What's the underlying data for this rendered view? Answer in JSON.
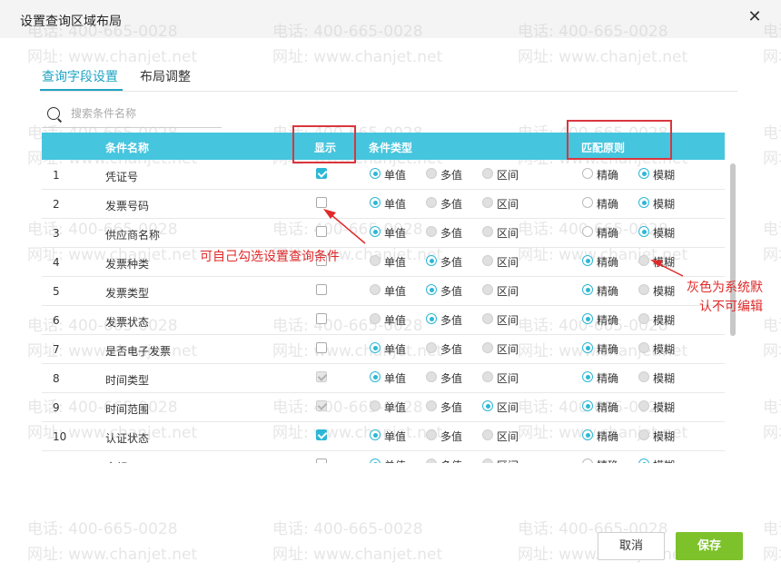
{
  "dialog": {
    "title": "设置查询区域布局",
    "close_icon": "close-icon"
  },
  "watermark": {
    "phone": "电话: 400-665-0028",
    "site": "网址: www.chanjet.net"
  },
  "tabs": [
    {
      "label": "查询字段设置",
      "active": true
    },
    {
      "label": "布局调整",
      "active": false
    }
  ],
  "search": {
    "placeholder": "搜索条件名称",
    "value": ""
  },
  "grid": {
    "columns": {
      "name": "条件名称",
      "show": "显示",
      "type": "条件类型",
      "match": "匹配原则"
    },
    "type_options": [
      "单值",
      "多值",
      "区间"
    ],
    "match_options": [
      "精确",
      "模糊"
    ],
    "rows": [
      {
        "num": "1",
        "name": "凭证号",
        "show": "checked",
        "type": 0,
        "match": 1,
        "match_disabled": null
      },
      {
        "num": "2",
        "name": "发票号码",
        "show": "unchecked",
        "type": 0,
        "match": 1,
        "match_disabled": null
      },
      {
        "num": "3",
        "name": "供应商名称",
        "show": "unchecked",
        "type": 0,
        "match": 1,
        "match_disabled": null
      },
      {
        "num": "4",
        "name": "发票种类",
        "show": "unchecked",
        "type": 1,
        "match": 0,
        "match_disabled": 1
      },
      {
        "num": "5",
        "name": "发票类型",
        "show": "unchecked",
        "type": 1,
        "match": 0,
        "match_disabled": 1
      },
      {
        "num": "6",
        "name": "发票状态",
        "show": "unchecked",
        "type": 1,
        "match": 0,
        "match_disabled": 1
      },
      {
        "num": "7",
        "name": "是否电子发票",
        "show": "unchecked",
        "type": 0,
        "match": 0,
        "match_disabled": 1
      },
      {
        "num": "8",
        "name": "时间类型",
        "show": "disabled-checked",
        "type": 0,
        "match": 0,
        "match_disabled": 1
      },
      {
        "num": "9",
        "name": "时间范围",
        "show": "disabled-checked",
        "type": 2,
        "match": 0,
        "match_disabled": 1
      },
      {
        "num": "10",
        "name": "认证状态",
        "show": "checked",
        "type": 0,
        "match": 0,
        "match_disabled": 1
      },
      {
        "num": "",
        "name": "金额",
        "show": "unchecked",
        "type": 0,
        "match": 1,
        "match_disabled": null
      }
    ]
  },
  "annotations": {
    "checkbox_note": "可自己勾选设置查询条件",
    "disabled_note_line1": "灰色为系统默",
    "disabled_note_line2": "认不可编辑",
    "color": "#e02a2a"
  },
  "footer": {
    "cancel_label": "取消",
    "save_label": "保存"
  },
  "colors": {
    "accent": "#2db7d6",
    "header_bg": "#46c5de",
    "save_green": "#7dc22a",
    "annotation_red": "#d9363e"
  }
}
